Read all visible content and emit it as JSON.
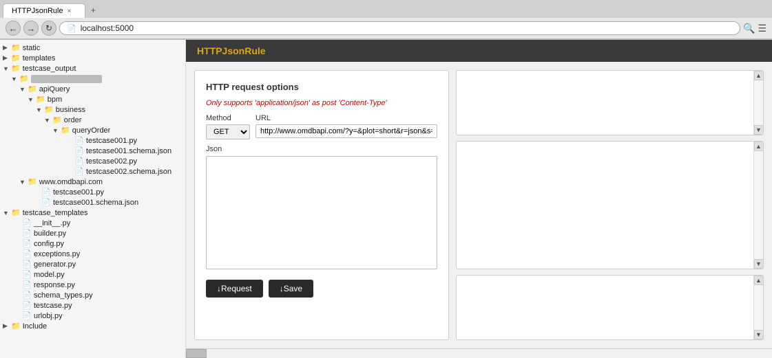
{
  "browser": {
    "tab_label": "HTTPJsonRule",
    "tab_close": "×",
    "tab_new": "+",
    "back_icon": "←",
    "forward_icon": "→",
    "refresh_icon": "↻",
    "address": "localhost:5000",
    "search_icon": "🔍",
    "menu_icon": "☰"
  },
  "app_header": {
    "title": "HTTPJsonRule"
  },
  "sidebar": {
    "items": [
      {
        "id": "static",
        "label": "static",
        "type": "folder",
        "indent": 0,
        "collapsed": true
      },
      {
        "id": "templates",
        "label": "templates",
        "type": "folder",
        "indent": 0,
        "collapsed": true
      },
      {
        "id": "testcase_output",
        "label": "testcase_output",
        "type": "folder",
        "indent": 0,
        "collapsed": false
      },
      {
        "id": "root_folder",
        "label": "",
        "type": "folder_greyed",
        "indent": 1,
        "collapsed": false
      },
      {
        "id": "apiQuery",
        "label": "apiQuery",
        "type": "folder",
        "indent": 2,
        "collapsed": false
      },
      {
        "id": "bpm",
        "label": "bpm",
        "type": "folder",
        "indent": 3,
        "collapsed": false
      },
      {
        "id": "business",
        "label": "business",
        "type": "folder",
        "indent": 4,
        "collapsed": false
      },
      {
        "id": "order",
        "label": "order",
        "type": "folder",
        "indent": 5,
        "collapsed": false
      },
      {
        "id": "queryOrder",
        "label": "queryOrder",
        "type": "folder",
        "indent": 6,
        "collapsed": false
      },
      {
        "id": "testcase001py",
        "label": "testcase001.py",
        "type": "file",
        "indent": 7
      },
      {
        "id": "testcase001schema",
        "label": "testcase001.schema.json",
        "type": "file",
        "indent": 7
      },
      {
        "id": "testcase002py",
        "label": "testcase002.py",
        "type": "file",
        "indent": 7
      },
      {
        "id": "testcase002schema",
        "label": "testcase002.schema.json",
        "type": "file",
        "indent": 7
      },
      {
        "id": "wwwomdbapi",
        "label": "www.omdbapi.com",
        "type": "folder",
        "indent": 2,
        "collapsed": false
      },
      {
        "id": "wwwtestcase001py",
        "label": "testcase001.py",
        "type": "file",
        "indent": 3
      },
      {
        "id": "wwwtestcase001schema",
        "label": "testcase001.schema.json",
        "type": "file",
        "indent": 3
      },
      {
        "id": "testcase_templates",
        "label": "testcase_templates",
        "type": "folder",
        "indent": 0,
        "collapsed": false
      },
      {
        "id": "init_py",
        "label": "__init__.py",
        "type": "file",
        "indent": 1
      },
      {
        "id": "builder_py",
        "label": "builder.py",
        "type": "file",
        "indent": 1
      },
      {
        "id": "config_py",
        "label": "config.py",
        "type": "file",
        "indent": 1
      },
      {
        "id": "exceptions_py",
        "label": "exceptions.py",
        "type": "file",
        "indent": 1
      },
      {
        "id": "generator_py",
        "label": "generator.py",
        "type": "file",
        "indent": 1
      },
      {
        "id": "model_py",
        "label": "model.py",
        "type": "file",
        "indent": 1
      },
      {
        "id": "response_py",
        "label": "response.py",
        "type": "file",
        "indent": 1
      },
      {
        "id": "schema_types_py",
        "label": "schema_types.py",
        "type": "file",
        "indent": 1
      },
      {
        "id": "testcase_py",
        "label": "testcase.py",
        "type": "file",
        "indent": 1
      },
      {
        "id": "urlobj_py",
        "label": "urlobj.py",
        "type": "file",
        "indent": 1
      },
      {
        "id": "include",
        "label": "Include",
        "type": "folder",
        "indent": 0,
        "collapsed": true
      }
    ]
  },
  "http_panel": {
    "title": "HTTP request options",
    "note": "Only supports 'application/json' as post 'Content-Type'",
    "method_label": "Method",
    "url_label": "URL",
    "method_value": "GET",
    "url_value": "http://www.omdbapi.com/?y=&plot=short&r=json&s=",
    "json_label": "Json",
    "json_value": "",
    "request_btn": "↓Request",
    "save_btn": "↓Save"
  }
}
